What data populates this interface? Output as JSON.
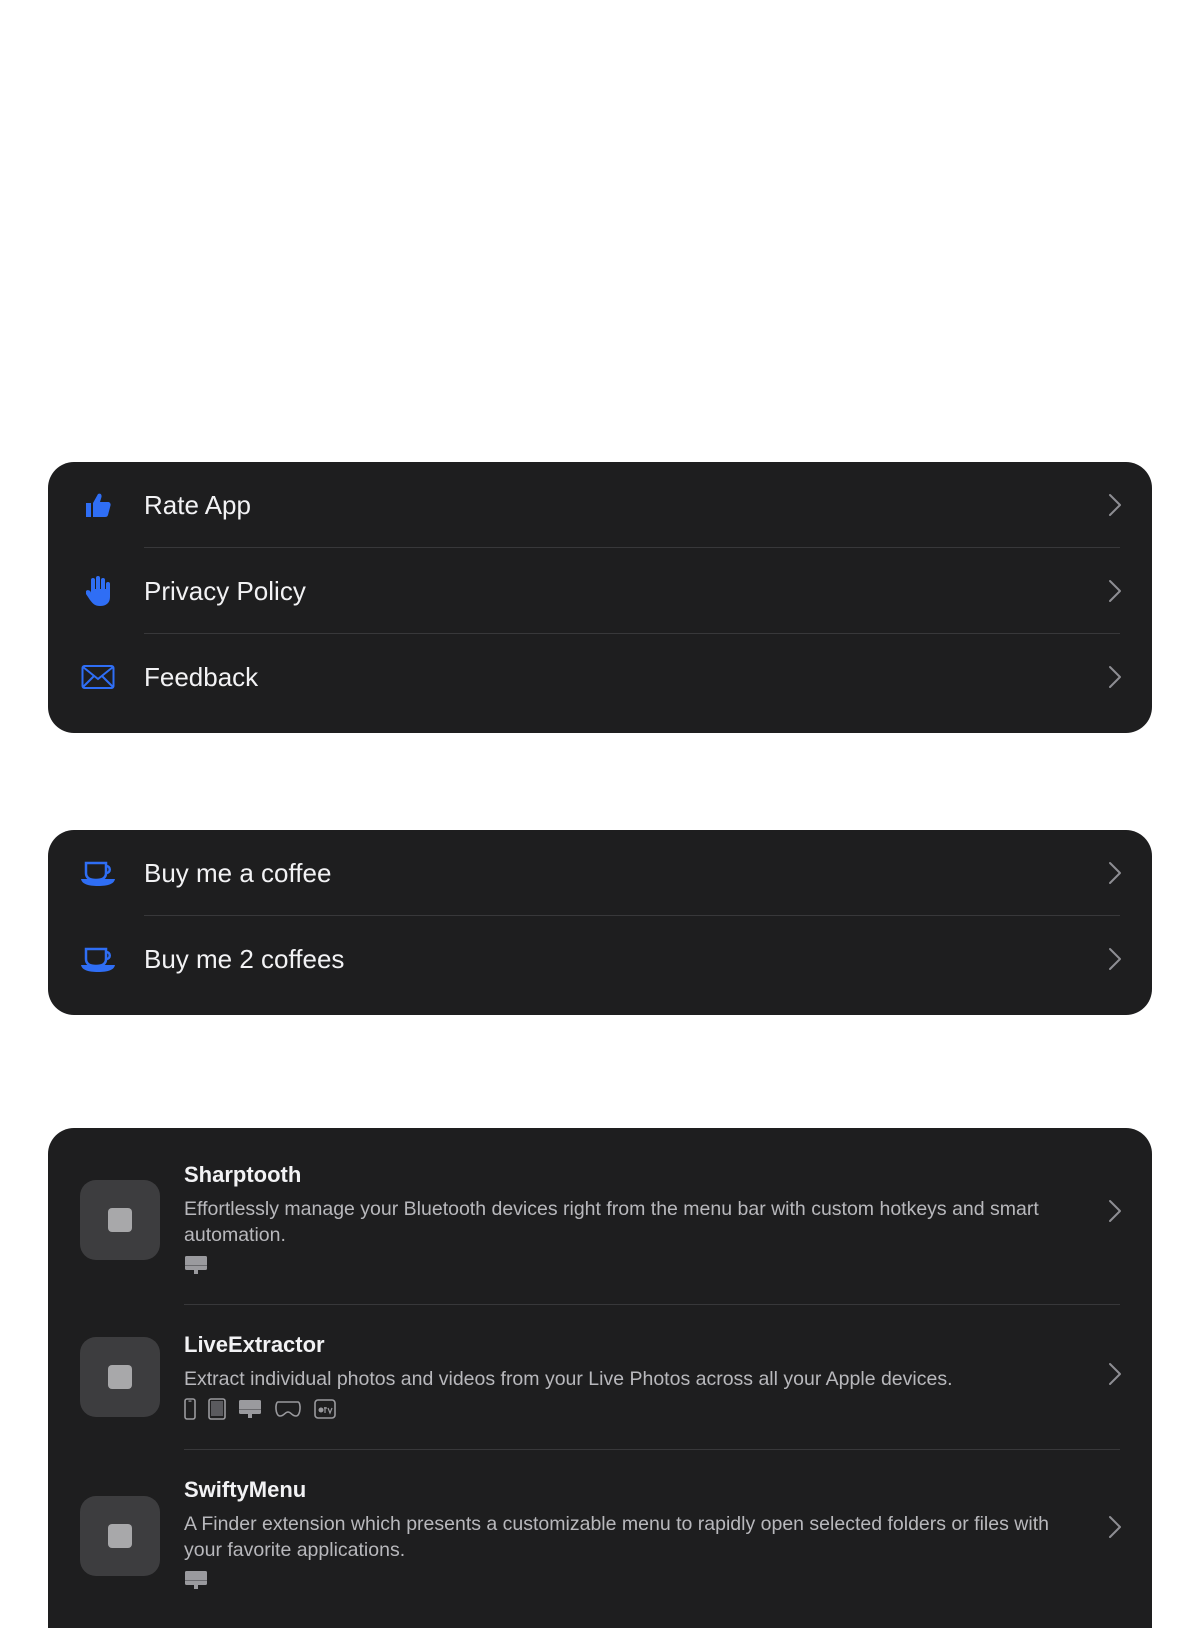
{
  "colors": {
    "accent": "#2f6ef5",
    "card_bg": "#1e1e1f",
    "page_bg": "#ffffff"
  },
  "support_section": {
    "items": [
      {
        "label": "Rate App",
        "icon": "thumbs-up-icon"
      },
      {
        "label": "Privacy Policy",
        "icon": "raised-hand-icon"
      },
      {
        "label": "Feedback",
        "icon": "envelope-icon"
      }
    ]
  },
  "tip_section": {
    "items": [
      {
        "label": "Buy me a coffee",
        "icon": "coffee-cup-icon"
      },
      {
        "label": "Buy me 2 coffees",
        "icon": "coffee-cup-icon"
      }
    ]
  },
  "apps_section": {
    "apps": [
      {
        "name": "Sharptooth",
        "description": "Effortlessly manage your Bluetooth devices right from the menu bar with custom hotkeys and smart automation.",
        "platforms": [
          "mac-icon"
        ]
      },
      {
        "name": "LiveExtractor",
        "description": "Extract individual photos and videos from your Live Photos across all your Apple devices.",
        "platforms": [
          "iphone-icon",
          "ipad-icon",
          "mac-icon",
          "vision-pro-icon",
          "apple-tv-icon"
        ]
      },
      {
        "name": "SwiftyMenu",
        "description": "A Finder extension which presents a customizable menu to rapidly open selected folders or files with your favorite applications.",
        "platforms": [
          "mac-icon"
        ]
      }
    ]
  }
}
